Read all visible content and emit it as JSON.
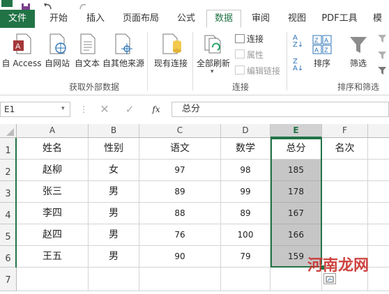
{
  "tabs": [
    {
      "label": "文件",
      "kind": "file"
    },
    {
      "label": "开始",
      "kind": "tab"
    },
    {
      "label": "插入",
      "kind": "tab"
    },
    {
      "label": "页面布局",
      "kind": "tab"
    },
    {
      "label": "公式",
      "kind": "tab"
    },
    {
      "label": "数据",
      "kind": "active"
    },
    {
      "label": "审阅",
      "kind": "tab"
    },
    {
      "label": "视图",
      "kind": "tab"
    },
    {
      "label": "PDF工具",
      "kind": "tab"
    },
    {
      "label": "模",
      "kind": "tab"
    }
  ],
  "ribbon": {
    "from_access": "自 Access",
    "from_web": "自网站",
    "from_text": "自文本",
    "from_other": "自其他来源",
    "existing": "现有连接",
    "refresh_all": "全部刷新",
    "connections": "连接",
    "properties": "属性",
    "edit_links": "编辑链接",
    "sort": "排序",
    "filter": "筛选",
    "group_external": "获取外部数据",
    "group_connections": "连接",
    "group_sort": "排序和筛选"
  },
  "formula_bar": {
    "name_box": "E1",
    "fx": "fx",
    "content": "总分"
  },
  "sheet": {
    "columns": [
      "A",
      "B",
      "C",
      "D",
      "E",
      "F"
    ],
    "rows": [
      [
        "姓名",
        "性别",
        "语文",
        "数学",
        "总分",
        "名次"
      ],
      [
        "赵柳",
        "女",
        "97",
        "98",
        "185",
        ""
      ],
      [
        "张三",
        "男",
        "89",
        "99",
        "178",
        ""
      ],
      [
        "李四",
        "男",
        "88",
        "89",
        "167",
        ""
      ],
      [
        "赵四",
        "男",
        "76",
        "100",
        "166",
        ""
      ],
      [
        "王五",
        "男",
        "90",
        "79",
        "159",
        ""
      ]
    ],
    "row_numbers": [
      "1",
      "2",
      "3",
      "4",
      "5",
      "6",
      "7"
    ],
    "selected_column": "E",
    "selected_color": "#c6c6c6",
    "accent_color": "#217346"
  },
  "watermark": "河南龙网"
}
